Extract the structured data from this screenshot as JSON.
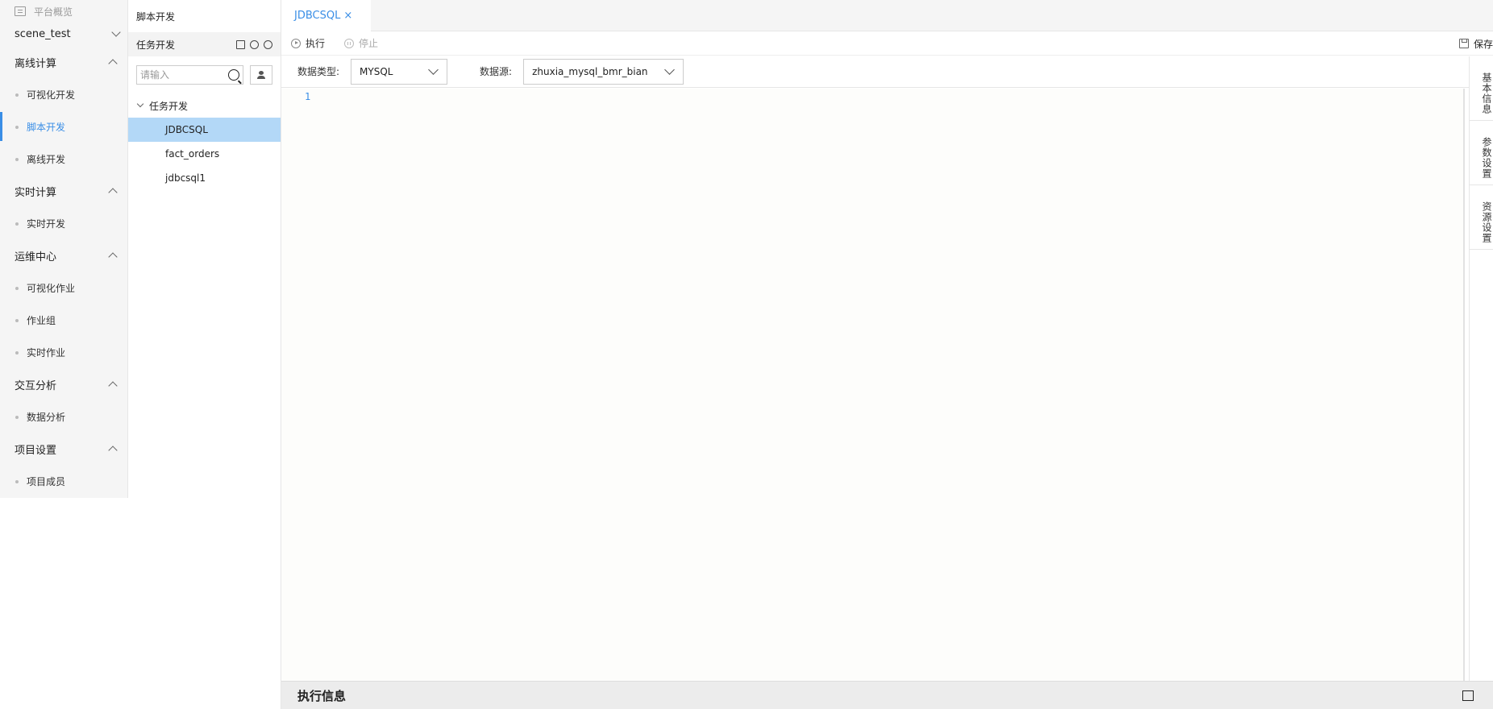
{
  "nav": {
    "overview_label": "平台概览",
    "project_name": "scene_test",
    "groups": [
      {
        "title": "离线计算",
        "items": [
          {
            "label": "可视化开发"
          },
          {
            "label": "脚本开发",
            "active": true
          },
          {
            "label": "离线开发"
          }
        ]
      },
      {
        "title": "实时计算",
        "items": [
          {
            "label": "实时开发"
          }
        ]
      },
      {
        "title": "运维中心",
        "items": [
          {
            "label": "可视化作业"
          },
          {
            "label": "作业组"
          },
          {
            "label": "实时作业"
          }
        ]
      },
      {
        "title": "交互分析",
        "items": [
          {
            "label": "数据分析"
          }
        ]
      },
      {
        "title": "项目设置",
        "items": [
          {
            "label": "项目成员"
          }
        ]
      }
    ]
  },
  "tree": {
    "title": "脚本开发",
    "subtitle": "任务开发",
    "search_placeholder": "请输入",
    "folder_label": "任务开发",
    "files": [
      {
        "label": "JDBCSQL",
        "selected": true
      },
      {
        "label": "fact_orders"
      },
      {
        "label": "jdbcsql1"
      }
    ]
  },
  "tabs": [
    {
      "label": "JDBCSQL",
      "close": "×"
    }
  ],
  "toolbar": {
    "run_label": "执行",
    "stop_label": "停止",
    "save_label": "保存"
  },
  "params": {
    "type_label": "数据类型:",
    "type_value": "MYSQL",
    "source_label": "数据源:",
    "source_value": "zhuxia_mysql_bmr_bian"
  },
  "editor": {
    "line_number": "1"
  },
  "right_panel": [
    {
      "label": "基本信息"
    },
    {
      "label": "参数设置"
    },
    {
      "label": "资源设置"
    }
  ],
  "bottom": {
    "title": "执行信息"
  },
  "colors": {
    "accent": "#3a8ee6",
    "selected_row": "#b3d8f7",
    "nav_bg": "#f5f5f5"
  }
}
